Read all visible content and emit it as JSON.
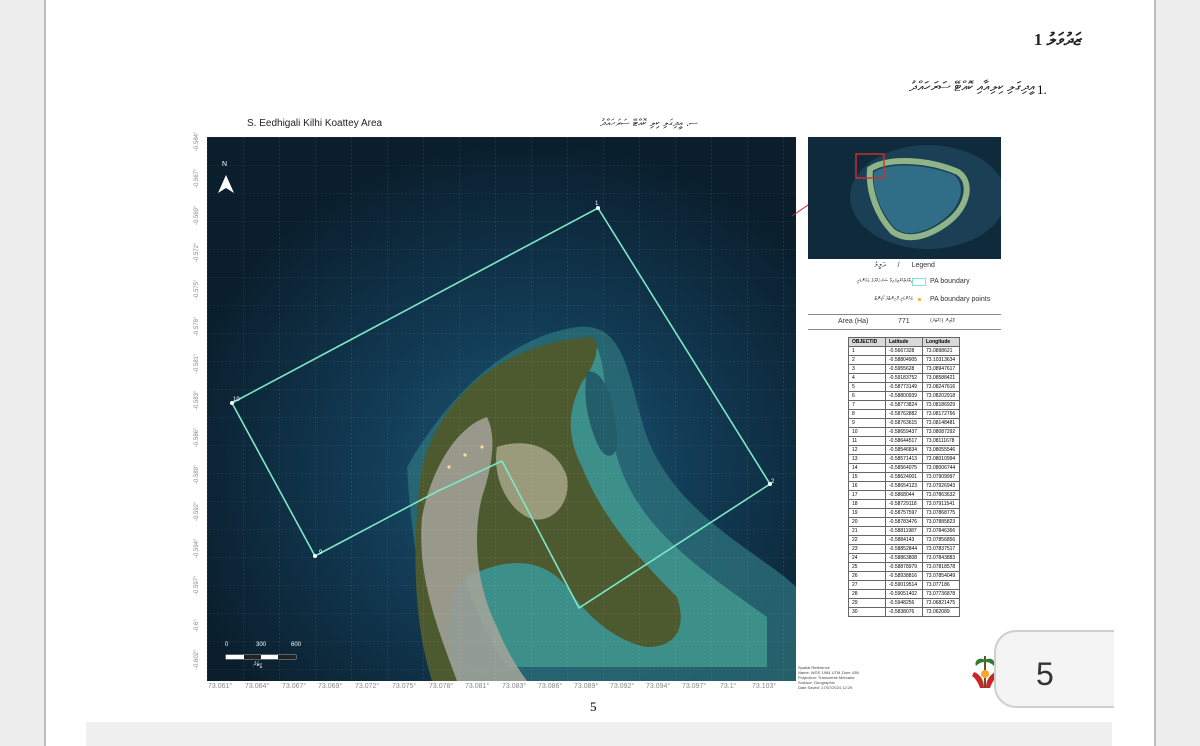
{
  "document": {
    "heading": "ޒަދުވަލު 1",
    "item_number": "1.",
    "item_text": "އީދިގަލި ކިލިއާއި ކޮއްޓޭ ސަރަހައްދު",
    "page_number": "5",
    "page_badge": "5"
  },
  "map": {
    "title": "S. Eedhigali Kilhi Koattey Area",
    "title_dv": "ސ. އީދިގަލި ކިލި ކޮއްޓޭ ސަރަހައްދު",
    "north_label": "N",
    "boundary_points": [
      "1",
      "2",
      "9",
      "10"
    ],
    "scale_bar": {
      "labels": [
        "0",
        "300",
        "600"
      ],
      "unit": "މީޓަރު"
    },
    "lat_ticks": [
      "-0.584°",
      "-0.567°",
      "-0.569°",
      "-0.572°",
      "-0.575°",
      "-0.578°",
      "-0.581°",
      "-0.583°",
      "-0.586°",
      "-0.589°",
      "-0.592°",
      "-0.594°",
      "-0.597°",
      "-0.6°",
      "-0.602°"
    ],
    "lon_ticks": [
      "73.061°",
      "73.064°",
      "73.067°",
      "73.069°",
      "73.072°",
      "73.075°",
      "73.078°",
      "73.081°",
      "73.083°",
      "73.086°",
      "73.089°",
      "73.092°",
      "73.094°",
      "73.097°",
      "73.1°",
      "73.103°"
    ],
    "colors": {
      "boundary": "#7de8c8",
      "sea_deep": "#0a1e2c",
      "lagoon": "#3d8f8a",
      "land": "#4d5a2f"
    }
  },
  "legend": {
    "title_dv": "ދަލީލު",
    "separator": "/",
    "title": "Legend",
    "items": [
      {
        "label": "PA boundary",
        "label_dv": "ހިމާޔަތްކުރެވިފައިވާ ސަރަހައްދުގެ ބައުންޑަރީ",
        "symbol": "box"
      },
      {
        "label": "PA boundary points",
        "label_dv": "ބައުންޑަރީ ޕޮއިންޓްގެ ކޯޑިނޭޓް",
        "symbol": "dot"
      }
    ],
    "area_label": "Area (Ha)",
    "area_value": "771",
    "area_label_dv": "ބޮޑުމިން (ހެކްޓަރު)"
  },
  "coord_table": {
    "headers": [
      "OBJECTID",
      "Latitude",
      "Longitude"
    ],
    "rows": [
      [
        "1",
        "-0.5667328",
        "73.0898621"
      ],
      [
        "2",
        "-0.58804905",
        "73.10313634"
      ],
      [
        "3",
        "-0.5955628",
        "73.08947617"
      ],
      [
        "4",
        "-0.59183752",
        "73.08588421"
      ],
      [
        "5",
        "-0.58773149",
        "73.08247616"
      ],
      [
        "6",
        "-0.58800939",
        "73.08202918"
      ],
      [
        "7",
        "-0.58773824",
        "73.08186929"
      ],
      [
        "8",
        "-0.58762882",
        "73.08172766"
      ],
      [
        "9",
        "-0.58763615",
        "73.08148481"
      ],
      [
        "10",
        "-0.58659437",
        "73.08087292"
      ],
      [
        "11",
        "-0.58644517",
        "73.08111678"
      ],
      [
        "12",
        "-0.58546834",
        "73.08055546"
      ],
      [
        "13",
        "-0.58571413",
        "73.08010994"
      ],
      [
        "14",
        "-0.58564075",
        "73.08006744"
      ],
      [
        "15",
        "-0.58624001",
        "73.07909997"
      ],
      [
        "16",
        "-0.58654123",
        "73.07926943"
      ],
      [
        "17",
        "-0.5868044",
        "73.07863632"
      ],
      [
        "18",
        "-0.58729118",
        "73.07911541"
      ],
      [
        "19",
        "-0.58757597",
        "73.07868775"
      ],
      [
        "20",
        "-0.58783476",
        "73.07885823"
      ],
      [
        "21",
        "-0.58811987",
        "73.07846366"
      ],
      [
        "22",
        "-0.5884143",
        "73.07856856"
      ],
      [
        "23",
        "-0.58852844",
        "73.07837517"
      ],
      [
        "24",
        "-0.58863808",
        "73.07843883"
      ],
      [
        "25",
        "-0.58878979",
        "73.07818578"
      ],
      [
        "26",
        "-0.58938816",
        "73.07854049"
      ],
      [
        "27",
        "-0.59019514",
        "73.077186"
      ],
      [
        "28",
        "-0.59051402",
        "73.07736878"
      ],
      [
        "29",
        "-0.5948256",
        "73.06821475"
      ],
      [
        "30",
        "-0.5838076",
        "73.062089"
      ]
    ]
  },
  "map_info": [
    "Spatial Reference",
    "Name: WGS 1984 UTM Zone 43N",
    "Projection: Transverse Mercator",
    "Surface: Geographic",
    "Date Saved: 17/07/2024 12:29"
  ]
}
